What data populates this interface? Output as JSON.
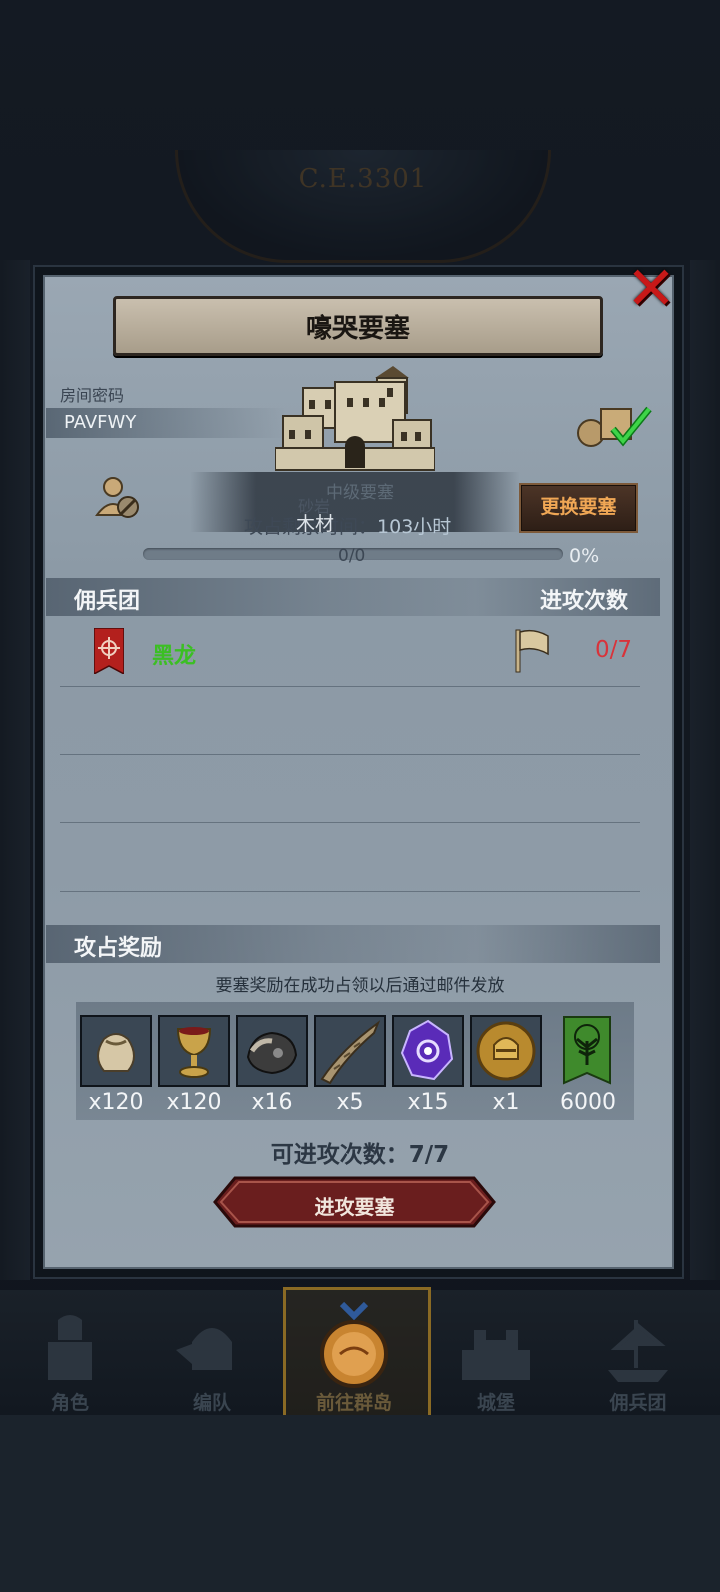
{
  "era": "C.E.3301",
  "dialog": {
    "title": "嚎哭要塞",
    "close_icon": "close-x-icon",
    "room_password_label": "房间密码",
    "room_code": "PAVFWY",
    "fort_level_text": "中级要塞",
    "overlap_text_a": "砂岩",
    "overlap_text_b": "木材",
    "occupy_time_prefix": "攻占剩余时间：",
    "occupy_time_value": "103小时",
    "change_button": "更换要塞",
    "progress_count": "0/0",
    "progress_percent": "0%",
    "progress_fraction": 0,
    "mercenary_header": "佣兵团",
    "attack_count_header": "进攻次数",
    "mercenaries": [
      {
        "name": "黑龙",
        "attacks": "0/7",
        "name_color": "#3bbf23",
        "count_color": "#d8333a"
      }
    ],
    "reward_header": "攻占奖励",
    "reward_note": "要塞奖励在成功占领以后通过邮件发放",
    "rewards": [
      {
        "icon": "sack-icon",
        "qty": "x120"
      },
      {
        "icon": "goblet-icon",
        "qty": "x120"
      },
      {
        "icon": "ore-icon",
        "qty": "x16"
      },
      {
        "icon": "horn-icon",
        "qty": "x5"
      },
      {
        "icon": "purple-crystal-icon",
        "qty": "x15"
      },
      {
        "icon": "knight-helmet-medal-icon",
        "qty": "x1"
      },
      {
        "icon": "tree-banner-icon",
        "qty": "6000"
      }
    ],
    "attack_available": "可进攻次数：7/7",
    "attack_button": "进攻要塞"
  },
  "bottom_nav": [
    {
      "label": "角色",
      "icon": "knight-icon"
    },
    {
      "label": "编队",
      "icon": "helmet-icon"
    },
    {
      "label": "前往群岛",
      "icon": "compass-icon",
      "active": true
    },
    {
      "label": "城堡",
      "icon": "castle-icon"
    },
    {
      "label": "佣兵团",
      "icon": "ship-icon"
    }
  ],
  "colors": {
    "accent_orange": "#f0a755",
    "success_green": "#3bbf23",
    "danger_red": "#d8333a"
  }
}
